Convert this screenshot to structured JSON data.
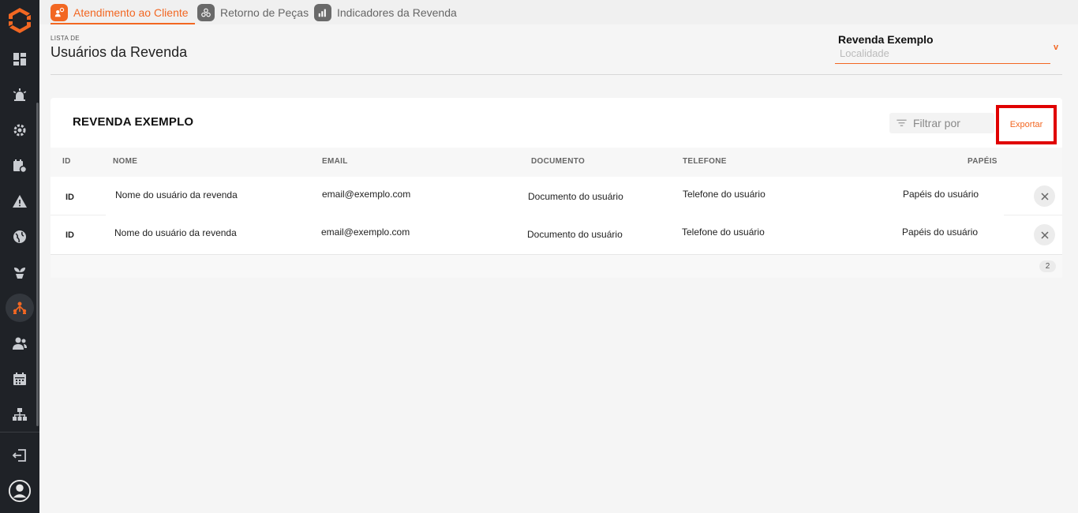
{
  "sidebar": {
    "icons": [
      "dashboard-icon",
      "alarm-icon",
      "settings-gear-icon",
      "calendar-clock-icon",
      "warning-icon",
      "globe-icon",
      "plant-icon",
      "network-people-icon",
      "users-icon",
      "calendar-icon",
      "hierarchy-icon",
      "logout-icon",
      "account-icon"
    ],
    "active": "network-people-icon"
  },
  "tabs": [
    {
      "label": "Atendimento ao Cliente",
      "icon": "customer-service-icon",
      "active": true
    },
    {
      "label": "Retorno de Peças",
      "icon": "parts-return-icon",
      "active": false
    },
    {
      "label": "Indicadores da Revenda",
      "icon": "bar-chart-icon",
      "active": false
    }
  ],
  "header": {
    "breadcrumb": "LISTA DE",
    "title": "Usuários da Revenda"
  },
  "revenda_select": {
    "name": "Revenda Exemplo",
    "placeholder": "Localidade"
  },
  "card": {
    "title": "REVENDA EXEMPLO",
    "filter_placeholder": "Filtrar por",
    "export_label": "Exportar"
  },
  "table": {
    "columns": [
      "ID",
      "NOME",
      "EMAIL",
      "DOCUMENTO",
      "TELEFONE",
      "PAPÉIS"
    ],
    "rows": [
      {
        "id": "ID",
        "nome": "Nome do usuário da revenda",
        "email": "email@exemplo.com",
        "documento": "Documento do usuário",
        "telefone": "Telefone do usuário",
        "papeis": "Papéis do usuário"
      },
      {
        "id": "ID",
        "nome": "Nome do usuário da revenda",
        "email": "email@exemplo.com",
        "documento": "Documento do usuário",
        "telefone": "Telefone do usuário",
        "papeis": "Papéis do usuário"
      }
    ],
    "total_count": "2"
  },
  "colors": {
    "accent": "#f26722",
    "sidebar_bg": "#1f2227",
    "highlight_border": "#e00000"
  }
}
